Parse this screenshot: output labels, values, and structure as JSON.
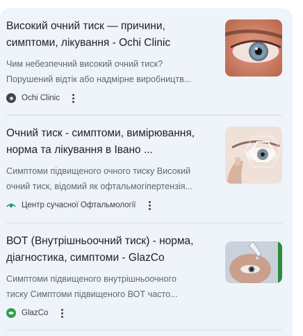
{
  "results": [
    {
      "title_line1": "Високий очний тиск — причини,",
      "title_line2": "симптоми, лікування - Ochi Clinic",
      "snippet_line1": "Чим небезпечний високий очний тиск?",
      "snippet_line2": "Порушений відтік або надмірне виробництв...",
      "source": "Ochi Clinic",
      "favicon_icon": "ochi-clinic-logo-icon",
      "thumbnail_icon": "eye-closeup-image"
    },
    {
      "title_line1": "Очний тиск - симптоми, вимірювання,",
      "title_line2": "норма та лікування в Івано ...",
      "snippet_line1": "Симптоми підвищеного очного тиску Високий",
      "snippet_line2": "очний тиск, відомий як офтальмогіпертензія...",
      "source": "Центр сучасної Офтальмології",
      "favicon_icon": "ophthalmology-center-logo-icon",
      "thumbnail_icon": "eye-scan-image"
    },
    {
      "title_line1": "ВОТ (Внутрішньоочний тиск) - норма,",
      "title_line2": "діагностика, симптоми - GlazCo",
      "snippet_line1": "Симптоми підвищеного внутрішньоочного",
      "snippet_line2": "тиску Симптоми підвищеного ВОТ часто...",
      "source": "GlazCo",
      "favicon_icon": "glazco-logo-icon",
      "thumbnail_icon": "eye-drops-image"
    }
  ],
  "colors": {
    "panel_background": "#eff3fa",
    "title_text": "#1f1f1f",
    "snippet_text": "#5f6673",
    "divider": "#d6dbe3"
  }
}
